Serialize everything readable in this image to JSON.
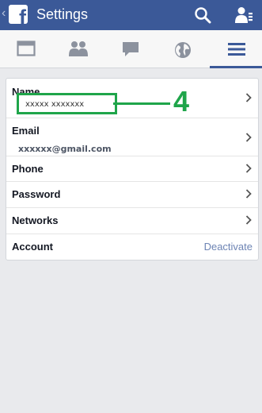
{
  "header": {
    "title": "Settings",
    "back_glyph": "‹"
  },
  "tabs": [
    {
      "name": "news-feed",
      "icon": "news-feed-icon"
    },
    {
      "name": "friends",
      "icon": "friends-icon"
    },
    {
      "name": "messages",
      "icon": "messages-icon"
    },
    {
      "name": "notifications",
      "icon": "globe-icon"
    },
    {
      "name": "menu",
      "icon": "hamburger-menu-icon",
      "active": true
    }
  ],
  "settings": {
    "name_label": "Name",
    "name_value": "xxxxx xxxxxxx",
    "email_label": "Email",
    "email_value": "xxxxxx@gmail.com",
    "phone_label": "Phone",
    "password_label": "Password",
    "networks_label": "Networks",
    "account_label": "Account",
    "deactivate_label": "Deactivate"
  },
  "annotation": {
    "step_number": "4"
  },
  "colors": {
    "brand": "#3b5998",
    "highlight": "#1fa54a",
    "link": "#6d84b4"
  }
}
